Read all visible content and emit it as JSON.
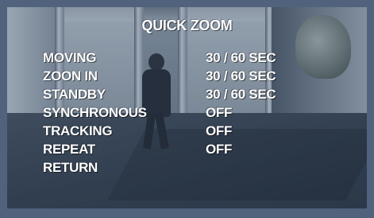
{
  "osd": {
    "title": "QUICK ZOOM",
    "items": [
      {
        "label": "MOVING",
        "value": "30 / 60 SEC"
      },
      {
        "label": "ZOON IN",
        "value": "30 / 60 SEC"
      },
      {
        "label": "STANDBY",
        "value": "30 / 60 SEC"
      },
      {
        "label": "SYNCHRONOUS",
        "value": "OFF"
      },
      {
        "label": "TRACKING",
        "value": "OFF"
      },
      {
        "label": "REPEAT",
        "value": "OFF"
      },
      {
        "label": "RETURN",
        "value": ""
      }
    ]
  },
  "colors": {
    "frame": "#51627c",
    "text": "#ffffff"
  }
}
